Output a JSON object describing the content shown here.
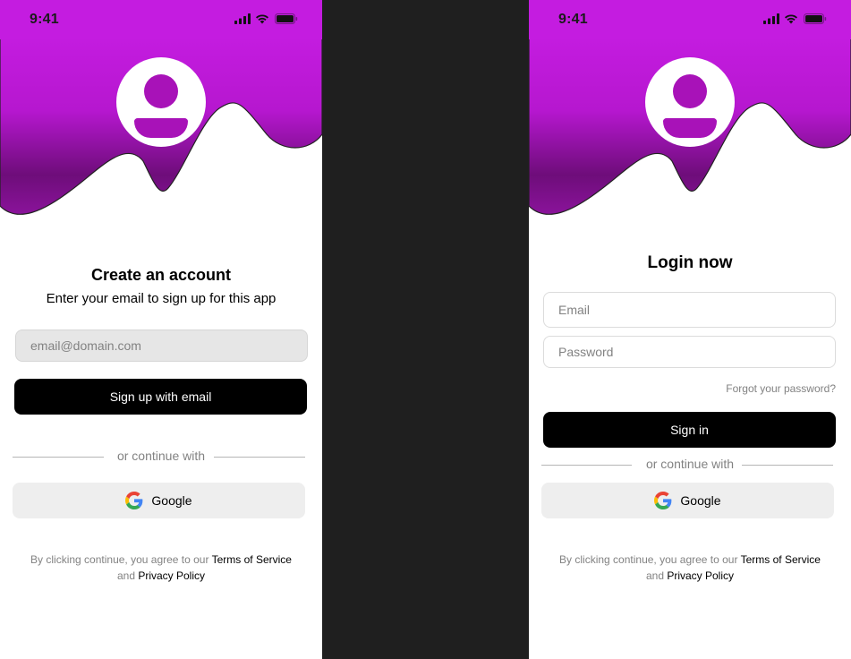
{
  "colors": {
    "accent": "#c41ce0",
    "wave_dark": "#6a0f74",
    "primary_button": "#000000",
    "secondary_button": "#eeeeee",
    "backdrop": "#1f1f1f"
  },
  "status_bar": {
    "time": "9:41",
    "icons": [
      "cellular-signal-icon",
      "wifi-icon",
      "battery-icon"
    ]
  },
  "signup": {
    "avatar_icon": "user-icon",
    "title": "Create an account",
    "subtitle": "Enter your email to sign up for this app",
    "email_placeholder": "email@domain.com",
    "submit_label": "Sign up with email",
    "divider_text": "or continue with",
    "google_label": "Google",
    "legal_prefix": "By clicking continue, you agree to our ",
    "terms_label": "Terms of Service",
    "legal_and": "and ",
    "privacy_label": "Privacy Policy"
  },
  "login": {
    "avatar_icon": "user-icon",
    "title": "Login now",
    "email_placeholder": "Email",
    "password_placeholder": "Password",
    "forgot_label": "Forgot your password?",
    "submit_label": "Sign in",
    "divider_text": "or continue with",
    "google_label": "Google",
    "legal_prefix": "By clicking continue, you agree to our ",
    "terms_label": "Terms of Service",
    "legal_and": "and ",
    "privacy_label": "Privacy Policy"
  }
}
